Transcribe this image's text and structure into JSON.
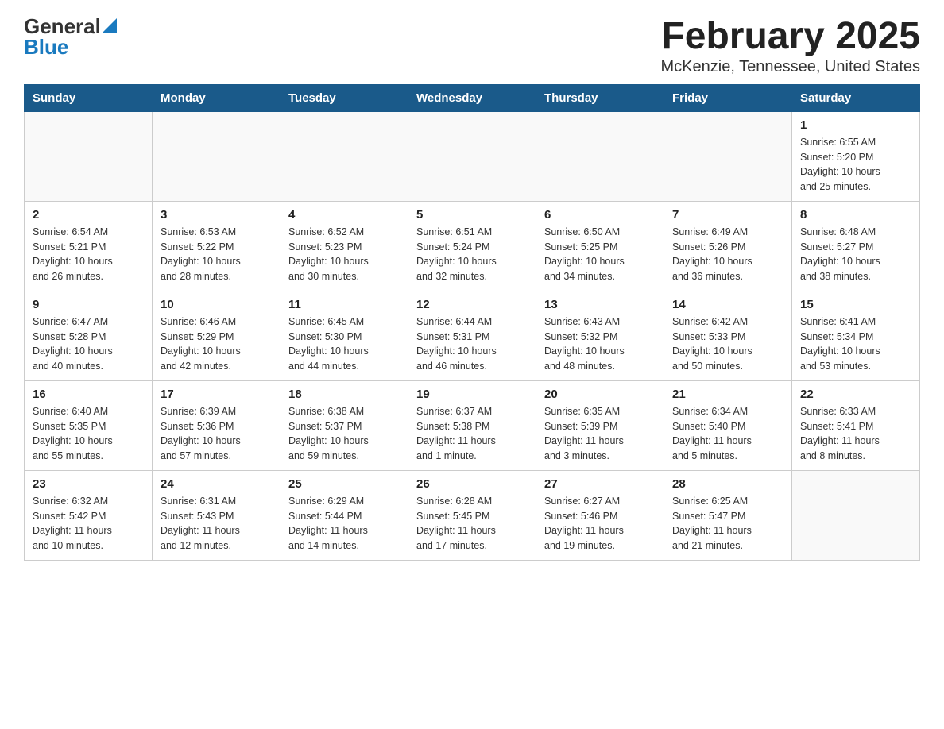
{
  "logo": {
    "general": "General",
    "blue": "Blue"
  },
  "title": "February 2025",
  "location": "McKenzie, Tennessee, United States",
  "weekdays": [
    "Sunday",
    "Monday",
    "Tuesday",
    "Wednesday",
    "Thursday",
    "Friday",
    "Saturday"
  ],
  "weeks": [
    [
      {
        "day": "",
        "info": ""
      },
      {
        "day": "",
        "info": ""
      },
      {
        "day": "",
        "info": ""
      },
      {
        "day": "",
        "info": ""
      },
      {
        "day": "",
        "info": ""
      },
      {
        "day": "",
        "info": ""
      },
      {
        "day": "1",
        "info": "Sunrise: 6:55 AM\nSunset: 5:20 PM\nDaylight: 10 hours\nand 25 minutes."
      }
    ],
    [
      {
        "day": "2",
        "info": "Sunrise: 6:54 AM\nSunset: 5:21 PM\nDaylight: 10 hours\nand 26 minutes."
      },
      {
        "day": "3",
        "info": "Sunrise: 6:53 AM\nSunset: 5:22 PM\nDaylight: 10 hours\nand 28 minutes."
      },
      {
        "day": "4",
        "info": "Sunrise: 6:52 AM\nSunset: 5:23 PM\nDaylight: 10 hours\nand 30 minutes."
      },
      {
        "day": "5",
        "info": "Sunrise: 6:51 AM\nSunset: 5:24 PM\nDaylight: 10 hours\nand 32 minutes."
      },
      {
        "day": "6",
        "info": "Sunrise: 6:50 AM\nSunset: 5:25 PM\nDaylight: 10 hours\nand 34 minutes."
      },
      {
        "day": "7",
        "info": "Sunrise: 6:49 AM\nSunset: 5:26 PM\nDaylight: 10 hours\nand 36 minutes."
      },
      {
        "day": "8",
        "info": "Sunrise: 6:48 AM\nSunset: 5:27 PM\nDaylight: 10 hours\nand 38 minutes."
      }
    ],
    [
      {
        "day": "9",
        "info": "Sunrise: 6:47 AM\nSunset: 5:28 PM\nDaylight: 10 hours\nand 40 minutes."
      },
      {
        "day": "10",
        "info": "Sunrise: 6:46 AM\nSunset: 5:29 PM\nDaylight: 10 hours\nand 42 minutes."
      },
      {
        "day": "11",
        "info": "Sunrise: 6:45 AM\nSunset: 5:30 PM\nDaylight: 10 hours\nand 44 minutes."
      },
      {
        "day": "12",
        "info": "Sunrise: 6:44 AM\nSunset: 5:31 PM\nDaylight: 10 hours\nand 46 minutes."
      },
      {
        "day": "13",
        "info": "Sunrise: 6:43 AM\nSunset: 5:32 PM\nDaylight: 10 hours\nand 48 minutes."
      },
      {
        "day": "14",
        "info": "Sunrise: 6:42 AM\nSunset: 5:33 PM\nDaylight: 10 hours\nand 50 minutes."
      },
      {
        "day": "15",
        "info": "Sunrise: 6:41 AM\nSunset: 5:34 PM\nDaylight: 10 hours\nand 53 minutes."
      }
    ],
    [
      {
        "day": "16",
        "info": "Sunrise: 6:40 AM\nSunset: 5:35 PM\nDaylight: 10 hours\nand 55 minutes."
      },
      {
        "day": "17",
        "info": "Sunrise: 6:39 AM\nSunset: 5:36 PM\nDaylight: 10 hours\nand 57 minutes."
      },
      {
        "day": "18",
        "info": "Sunrise: 6:38 AM\nSunset: 5:37 PM\nDaylight: 10 hours\nand 59 minutes."
      },
      {
        "day": "19",
        "info": "Sunrise: 6:37 AM\nSunset: 5:38 PM\nDaylight: 11 hours\nand 1 minute."
      },
      {
        "day": "20",
        "info": "Sunrise: 6:35 AM\nSunset: 5:39 PM\nDaylight: 11 hours\nand 3 minutes."
      },
      {
        "day": "21",
        "info": "Sunrise: 6:34 AM\nSunset: 5:40 PM\nDaylight: 11 hours\nand 5 minutes."
      },
      {
        "day": "22",
        "info": "Sunrise: 6:33 AM\nSunset: 5:41 PM\nDaylight: 11 hours\nand 8 minutes."
      }
    ],
    [
      {
        "day": "23",
        "info": "Sunrise: 6:32 AM\nSunset: 5:42 PM\nDaylight: 11 hours\nand 10 minutes."
      },
      {
        "day": "24",
        "info": "Sunrise: 6:31 AM\nSunset: 5:43 PM\nDaylight: 11 hours\nand 12 minutes."
      },
      {
        "day": "25",
        "info": "Sunrise: 6:29 AM\nSunset: 5:44 PM\nDaylight: 11 hours\nand 14 minutes."
      },
      {
        "day": "26",
        "info": "Sunrise: 6:28 AM\nSunset: 5:45 PM\nDaylight: 11 hours\nand 17 minutes."
      },
      {
        "day": "27",
        "info": "Sunrise: 6:27 AM\nSunset: 5:46 PM\nDaylight: 11 hours\nand 19 minutes."
      },
      {
        "day": "28",
        "info": "Sunrise: 6:25 AM\nSunset: 5:47 PM\nDaylight: 11 hours\nand 21 minutes."
      },
      {
        "day": "",
        "info": ""
      }
    ]
  ]
}
